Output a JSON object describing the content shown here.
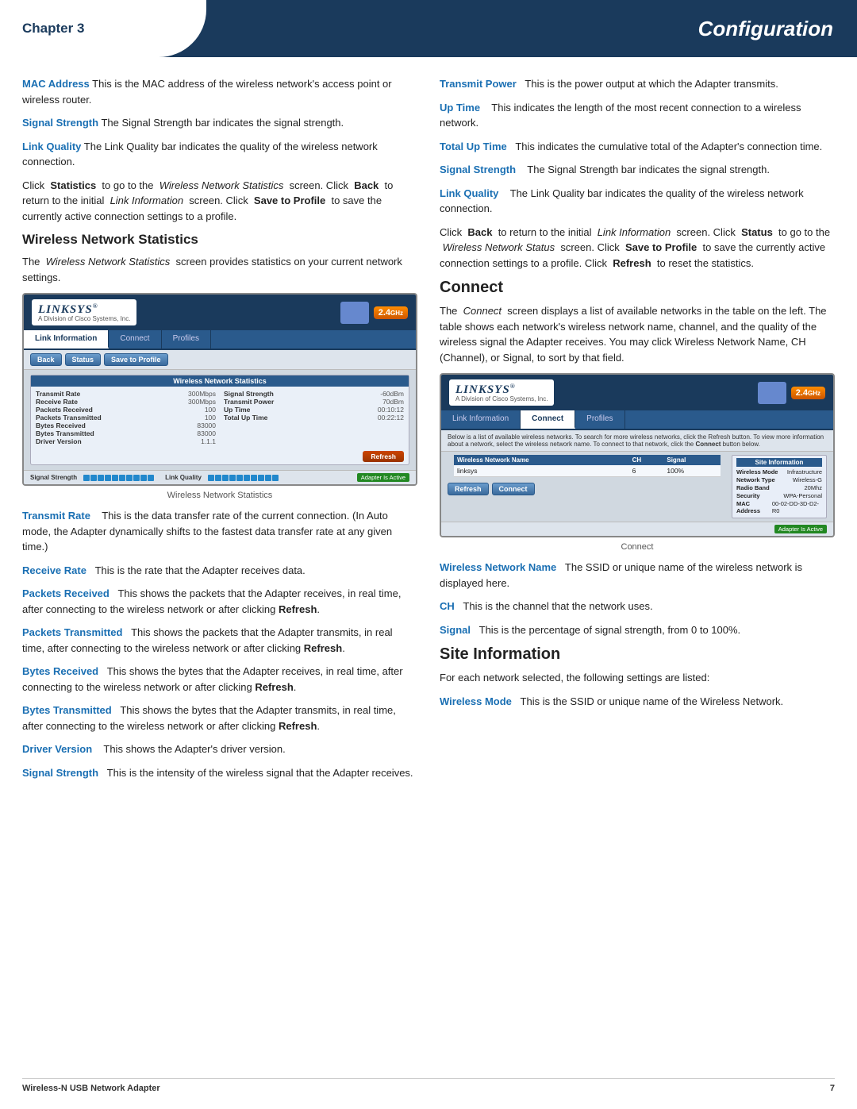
{
  "header": {
    "chapter": "Chapter 3",
    "title": "Configuration"
  },
  "footer": {
    "left": "Wireless-N USB Network Adapter",
    "right": "7"
  },
  "left_column": {
    "paragraphs": [
      {
        "term": "MAC Address",
        "body": " This is the MAC address of the wireless network's access point or wireless router."
      },
      {
        "term": "Signal Strength",
        "body": " The Signal Strength bar indicates the signal strength."
      },
      {
        "term": "Link Quality",
        "body": " The Link Quality bar indicates the quality of the wireless network connection."
      }
    ],
    "click_para": "Click  Statistics  to go to the  Wireless Network Statistics  screen. Click  Back  to return to the initial  Link Information  screen. Click  Save to Profile  to save the currently active connection settings to a profile.",
    "wns_heading": "Wireless Network Statistics",
    "wns_intro": "The  Wireless Network Statistics  screen provides statistics on your current network settings.",
    "screenshot1": {
      "logo": "LINKSYS",
      "logo_sub": "A Division of Cisco Systems, Inc.",
      "tabs": [
        "Link Information",
        "Connect",
        "Profiles"
      ],
      "active_tab": "Link Information",
      "buttons": [
        "Back",
        "Status",
        "Save to Profile"
      ],
      "badge": "2.4GHz",
      "stats_heading": "Wireless Network Statistics",
      "stats": [
        {
          "label": "Transmit Rate",
          "value": "300Mbps",
          "label2": "Signal Strength",
          "value2": "-60dBm"
        },
        {
          "label": "Receive Rate",
          "value": "300Mbps",
          "label2": "Transmit Power",
          "value2": "70dBm"
        },
        {
          "label": "Packets Received",
          "value": "100",
          "label2": "Up Time",
          "value2": "00:10:12"
        },
        {
          "label": "Packets Transmitted",
          "value": "100",
          "label2": "Total Up Time",
          "value2": "00:22:12"
        },
        {
          "label": "Bytes Received",
          "value": "83000",
          "label2": "",
          "value2": ""
        },
        {
          "label": "Bytes Transmitted",
          "value": "83000",
          "label2": "",
          "value2": ""
        },
        {
          "label": "Driver Version",
          "value": "1.1.1",
          "label2": "",
          "value2": ""
        }
      ],
      "refresh_btn": "Refresh",
      "signal_label": "Signal Strength",
      "link_label": "Link Quality",
      "adapter_status": "Adapter Is Active"
    },
    "caption1": "Wireless Network Statistics",
    "term_paras": [
      {
        "term": "Transmit Rate",
        "body": "   This is the data transfer rate of the current connection. (In Auto mode, the Adapter dynamically shifts to the fastest data transfer rate at any given time.)"
      },
      {
        "term": "Receive Rate",
        "body": "  This is the rate that the Adapter receives data."
      },
      {
        "term": "Packets Received",
        "body": "  This shows the packets that the Adapter receives, in real time, after connecting to the wireless network or after clicking  Refresh."
      },
      {
        "term": "Packets Transmitted",
        "body": "  This shows the packets that the Adapter transmits, in real time, after connecting to the wireless network or after clicking  Refresh."
      },
      {
        "term": "Bytes Received",
        "body": "  This shows the bytes that the Adapter receives, in real time, after connecting to the wireless network or after clicking  Refresh."
      },
      {
        "term": "Bytes Transmitted",
        "body": "  This shows the bytes that the Adapter transmits, in real time, after connecting to the wireless network or after clicking  Refresh."
      },
      {
        "term": "Driver Version",
        "body": "   This shows the Adapter's driver version."
      },
      {
        "term": "Signal Strength",
        "body": "  This is the intensity of the wireless signal that the Adapter receives."
      }
    ]
  },
  "right_column": {
    "term_paras_top": [
      {
        "term": "Transmit Power",
        "body": "  This is the power output at which the Adapter transmits."
      },
      {
        "term": "Up Time",
        "body": "   This indicates the length of the most recent connection to a wireless network."
      },
      {
        "term": "Total Up Time",
        "body": "  This indicates the cumulative total of the Adapter's connection time."
      },
      {
        "term": "Signal Strength",
        "body": "   The Signal Strength bar indicates the signal strength."
      },
      {
        "term": "Link Quality",
        "body": "   The Link Quality bar indicates the quality of the wireless network connection."
      }
    ],
    "click_para2": "Click  Back  to return to the initial  Link Information  screen. Click  Status  to go to the  Wireless Network Status  screen. Click  Save to Profile  to save the currently active connection settings to a profile. Click  Refresh  to reset the statistics.",
    "connect_heading": "Connect",
    "connect_intro": "The  Connect  screen displays a list of available networks in the table on the left. The table shows each network's wireless network name, channel, and the quality of the wireless signal the Adapter receives. You may click Wireless Network Name, CH (Channel), or Signal, to sort by that field.",
    "screenshot2": {
      "logo": "LINKSYS",
      "logo_sub": "A Division of Cisco Systems, Inc.",
      "tabs": [
        "Link Information",
        "Connect",
        "Profiles"
      ],
      "active_tab": "Connect",
      "badge": "2.4GHz",
      "desc": "Below is a list of available wireless networks. To search for more wireless networks, click the Refresh button. To view more information about a network, select the wireless network name. To connect to that network, click the Connect button below.",
      "table_headers": [
        "Wireless Network Name",
        "CH",
        "Signal"
      ],
      "table_rows": [
        {
          "name": "linksys",
          "ch": "6",
          "signal": "100%"
        }
      ],
      "site_info_title": "Site Information",
      "site_info": [
        {
          "label": "Wireless Mode",
          "value": "Infrastructure"
        },
        {
          "label": "Network Type",
          "value": "Wireless-G"
        },
        {
          "label": "Radio Band",
          "value": "20Mhz"
        },
        {
          "label": "Security",
          "value": "WPA-Personal"
        },
        {
          "label": "MAC Address",
          "value": "00-02-DD-3D-D2-R0"
        }
      ],
      "buttons": [
        "Refresh",
        "Connect"
      ],
      "adapter_status": "Adapter Is Active"
    },
    "caption2": "Connect",
    "term_paras_bottom": [
      {
        "term": "Wireless Network Name",
        "body": "  The SSID or unique name of the wireless network is displayed here."
      },
      {
        "term": "CH",
        "body": "  This is the channel that the network uses."
      },
      {
        "term": "Signal",
        "body": "  This is the percentage of signal strength, from 0 to 100%."
      }
    ],
    "site_info_heading": "Site Information",
    "site_info_intro": "For each network selected, the following settings are listed:",
    "wireless_mode_para": {
      "term": "Wireless Mode",
      "body": "  This is the SSID or unique name of the Wireless Network."
    }
  }
}
